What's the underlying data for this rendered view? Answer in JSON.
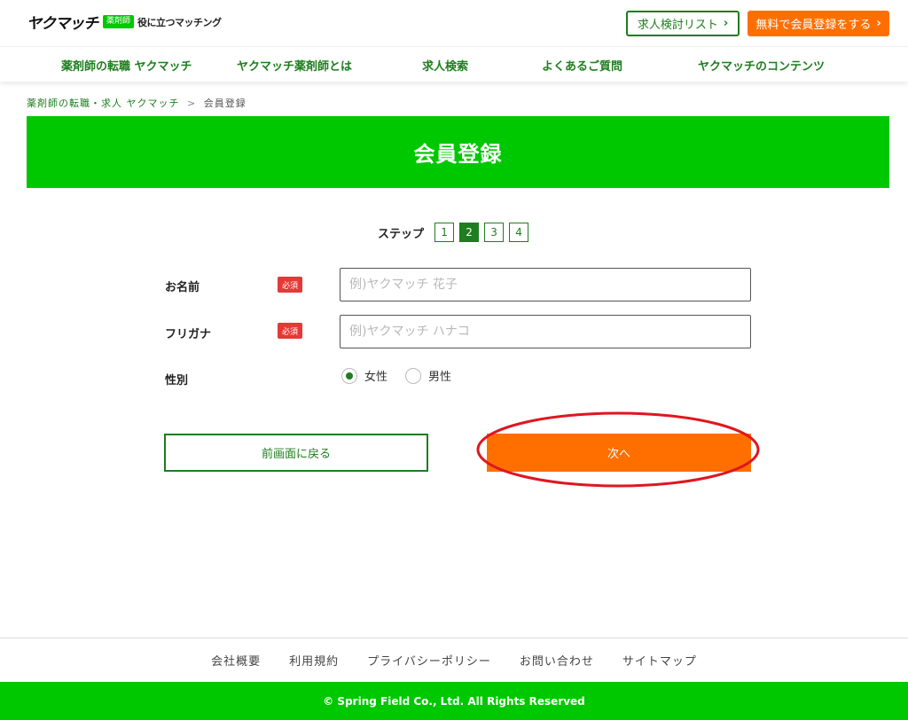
{
  "header": {
    "logo_text": "ヤクマッチ",
    "logo_badge": "薬剤師",
    "logo_tagline": "役に立つマッチング",
    "list_button": "求人検討リスト",
    "register_button": "無料で会員登録をする"
  },
  "nav": {
    "items": [
      {
        "label": "薬剤師の転職 ヤクマッチ"
      },
      {
        "label": "ヤクマッチ薬剤師とは"
      },
      {
        "label": "求人検索"
      },
      {
        "label": "よくあるご質問"
      },
      {
        "label": "ヤクマッチのコンテンツ"
      }
    ]
  },
  "breadcrumb": {
    "home": "薬剤師の転職・求人 ヤクマッチ",
    "separator": ">",
    "current": "会員登録"
  },
  "page": {
    "title": "会員登録"
  },
  "steps": {
    "label": "ステップ",
    "items": [
      "1",
      "2",
      "3",
      "4"
    ],
    "current": 2
  },
  "form": {
    "name": {
      "label": "お名前",
      "required": "必須",
      "placeholder": "例)ヤクマッチ 花子",
      "value": ""
    },
    "kana": {
      "label": "フリガナ",
      "required": "必須",
      "placeholder": "例)ヤクマッチ ハナコ",
      "value": ""
    },
    "gender": {
      "label": "性別",
      "options": [
        "女性",
        "男性"
      ],
      "selected": "女性"
    }
  },
  "actions": {
    "back": "前画面に戻る",
    "next": "次へ"
  },
  "footer": {
    "links": [
      "会社概要",
      "利用規約",
      "プライバシーポリシー",
      "お問い合わせ",
      "サイトマップ"
    ],
    "copyright": "© Spring Field Co., Ltd. All Rights Reserved"
  },
  "colors": {
    "brand_green": "#00c800",
    "dark_green": "#1e7d1e",
    "accent_orange": "#ff6f00",
    "required_red": "#e53935",
    "highlight_red": "#e0161f"
  }
}
